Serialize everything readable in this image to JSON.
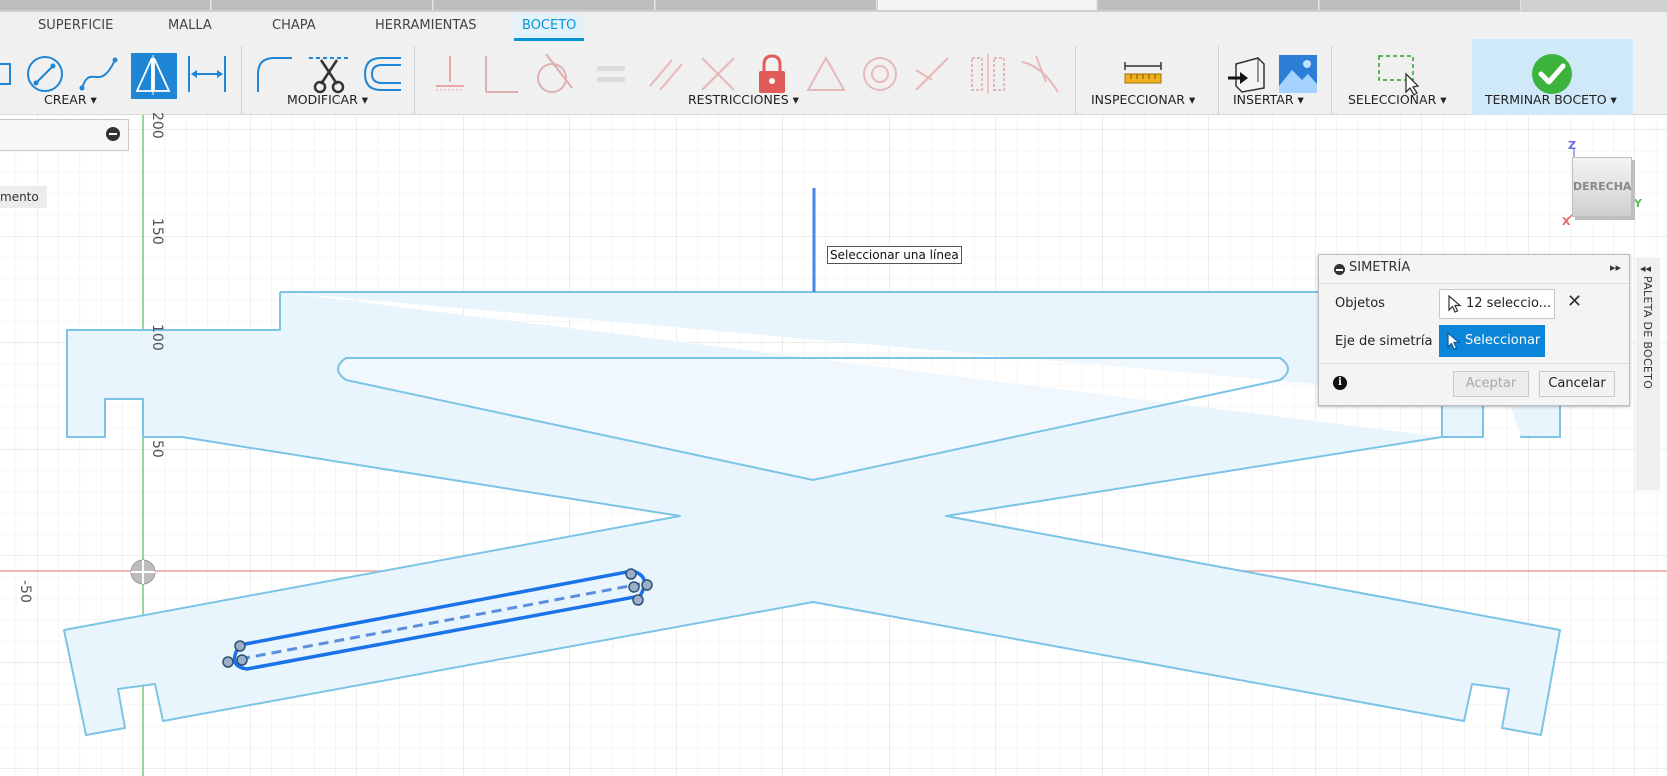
{
  "tabs": [
    "SUPERFICIE",
    "MALLA",
    "CHAPA",
    "HERRAMIENTAS",
    "BOCETO"
  ],
  "active_tab": "BOCETO",
  "groups": {
    "crear": "CREAR ▾",
    "modificar": "MODIFICAR ▾",
    "restricciones": "RESTRICCIONES ▾",
    "inspeccionar": "INSPECCIONAR ▾",
    "insertar": "INSERTAR ▾",
    "seleccionar": "SELECCIONAR ▾",
    "terminar": "TERMINAR BOCETO ▾"
  },
  "icons": {
    "crear": [
      "rectangle-icon",
      "circle-icon",
      "spline-icon",
      "mirror-icon",
      "dimension-icon"
    ],
    "modificar": [
      "fillet-icon",
      "trim-icon",
      "offset-icon"
    ],
    "restricciones": [
      "horizontal-vertical-icon",
      "coincident-icon",
      "tangent-icon",
      "equal-icon",
      "parallel-icon",
      "perpendicular-icon",
      "fix-lock-icon",
      "midpoint-icon",
      "concentric-icon",
      "collinear-icon",
      "symmetric-icon",
      "curvature-icon"
    ],
    "inspeccionar": [
      "measure-icon"
    ],
    "insertar": [
      "insert-derive-icon",
      "insert-image-icon"
    ],
    "seleccionar": [
      "window-select-icon"
    ],
    "terminar": [
      "finish-sketch-check-icon"
    ]
  },
  "colors": {
    "accent": "#0696d7",
    "sketch_line": "#7cc4e6",
    "sketch_fill": "#e9f5fc",
    "selected_line": "#1a73e8",
    "x_axis": "#f0a0a0",
    "y_axis": "#7ed07e",
    "lock": "#e25b5b",
    "finish_green": "#3cb43c"
  },
  "ruler": {
    "labels": [
      "200",
      "150",
      "100",
      "50",
      "-50"
    ]
  },
  "left_panel": {
    "tag_text": "mento"
  },
  "tooltip": "Seleccionar una línea",
  "dialog": {
    "title": "SIMETRÍA",
    "objects_label": "Objetos",
    "objects_value": "12 seleccio...",
    "axis_label": "Eje de simetría",
    "axis_button": "Seleccionar",
    "accept": "Aceptar",
    "cancel": "Cancelar"
  },
  "palette_tab": "PALETA DE BOCETO",
  "viewcube": {
    "face": "DERECHA",
    "axes": [
      "Z",
      "Y",
      "X"
    ]
  }
}
